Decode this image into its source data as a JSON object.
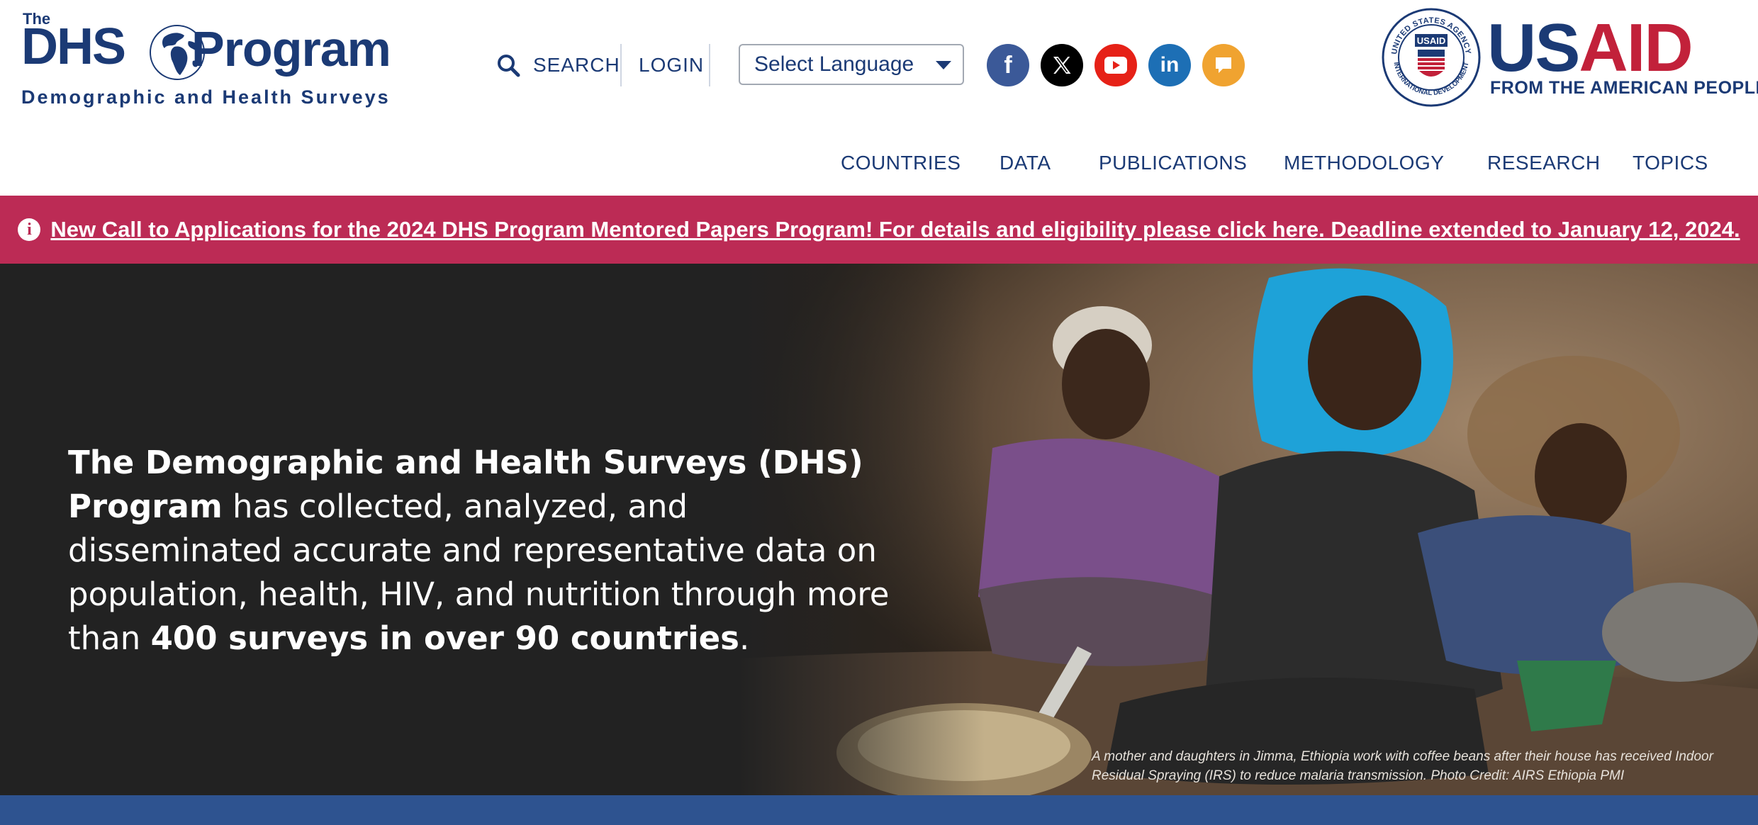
{
  "header": {
    "logo": {
      "the": "The",
      "dhs": "DHS",
      "program": "Program",
      "subtitle": "Demographic and Health Surveys"
    },
    "search_label": "SEARCH",
    "login_label": "LOGIN",
    "language_select": {
      "selected": "Select Language"
    },
    "social": [
      {
        "name": "facebook-icon",
        "glyph": "f",
        "color": "#3b5998"
      },
      {
        "name": "x-icon",
        "glyph": "X",
        "color": "#000000"
      },
      {
        "name": "youtube-icon",
        "glyph": "",
        "color": "#e62117"
      },
      {
        "name": "linkedin-icon",
        "glyph": "in",
        "color": "#1d6fb5"
      },
      {
        "name": "chat-icon",
        "glyph": "",
        "color": "#f0a330"
      }
    ],
    "usaid": {
      "us": "US",
      "aid": "AID",
      "tagline": "FROM THE AMERICAN PEOPLE",
      "seal_text_top": "UNITED STATES AGENCY",
      "seal_text_bottom": "INTERNATIONAL DEVELOPMENT",
      "seal_center": "USAID"
    },
    "nav": [
      "COUNTRIES",
      "DATA",
      "PUBLICATIONS",
      "METHODOLOGY",
      "RESEARCH",
      "TOPICS"
    ]
  },
  "alert": {
    "text": "New Call to Applications for the 2024 DHS Program Mentored Papers Program! For details and eligibility please click here. Deadline extended to January 12, 2024.",
    "icon": "info-icon"
  },
  "hero": {
    "bold_lead": "The Demographic and Health Surveys (DHS) Program",
    "text_1": " has collected, analyzed, and disseminated accurate and representative data on population, health, HIV, and nutrition through more than ",
    "bold_tail": "400 surveys in over 90 countries",
    "text_2": ".",
    "caption_line1": "A mother and daughters in Jimma, Ethiopia work with coffee beans after their house has received Indoor",
    "caption_line2": "Residual Spraying (IRS) to reduce malaria transmission. Photo Credit: AIRS Ethiopia PMI"
  },
  "colors": {
    "brand_navy": "#1b3a75",
    "alert": "#bc2b55",
    "hero_bg": "#222222",
    "footer_band": "#2e5390",
    "usaid_red": "#c2213a"
  }
}
